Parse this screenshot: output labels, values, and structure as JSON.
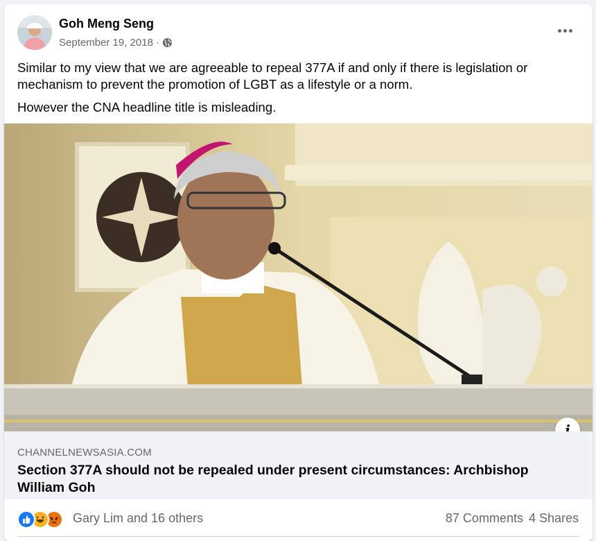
{
  "post": {
    "author": "Goh Meng Seng",
    "date": "September 19, 2018",
    "date_separator": "·",
    "privacy_icon": "globe-icon",
    "more_icon": "more-options-icon",
    "paragraphs": [
      "Similar to my view that we are agreeable to repeal 377A if and only if there is legislation or mechanism to prevent the promotion of LGBT as a lifestyle or a norm.",
      "However the CNA headline title is misleading."
    ]
  },
  "link_preview": {
    "domain": "CHANNELNEWSASIA.COM",
    "title": "Section 377A should not be repealed under present circumstances: Archbishop William Goh",
    "info_icon": "info-icon",
    "info_glyph": "i"
  },
  "reactions": {
    "icons": [
      "like-icon",
      "haha-icon",
      "angry-icon"
    ],
    "summary": "Gary Lim and 16 others",
    "comments": "87 Comments",
    "shares": "4 Shares"
  },
  "colors": {
    "background": "#f0f2f5",
    "card": "#ffffff",
    "secondary_text": "#65676b",
    "like_blue": "#1877f2",
    "haha_yellow": "#f7b125",
    "angry_orange": "#e9710f"
  }
}
